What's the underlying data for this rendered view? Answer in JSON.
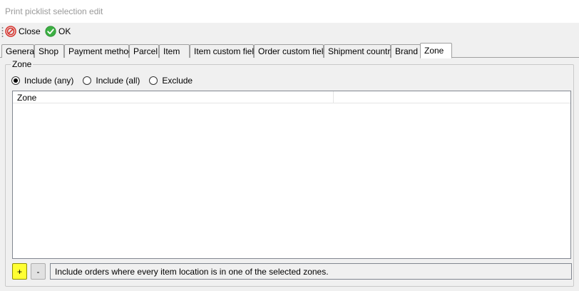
{
  "window": {
    "title": "Print picklist selection edit"
  },
  "toolbar": {
    "close_label": "Close",
    "ok_label": "OK",
    "close_icon": "close-icon",
    "ok_icon": "check-icon"
  },
  "tabs": [
    {
      "label": "General"
    },
    {
      "label": "Shop"
    },
    {
      "label": "Payment method"
    },
    {
      "label": "Parcel"
    },
    {
      "label": "Item"
    },
    {
      "label": "Item custom field"
    },
    {
      "label": "Order custom field"
    },
    {
      "label": "Shipment country"
    },
    {
      "label": "Brand"
    },
    {
      "label": "Zone",
      "active": true
    }
  ],
  "zone": {
    "group_title": "Zone",
    "radios": [
      {
        "label": "Include (any)",
        "selected": true
      },
      {
        "label": "Include (all)",
        "selected": false
      },
      {
        "label": "Exclude",
        "selected": false
      }
    ],
    "list": {
      "columns": [
        "Zone",
        ""
      ],
      "rows": []
    },
    "add_label": "+",
    "remove_label": "-",
    "hint": "Include orders where every item location is in one of the selected zones."
  },
  "colors": {
    "add_button": "#ffff33",
    "close_icon": "#d9322c",
    "ok_icon": "#3cb043",
    "title_text": "#9a9a9a"
  }
}
